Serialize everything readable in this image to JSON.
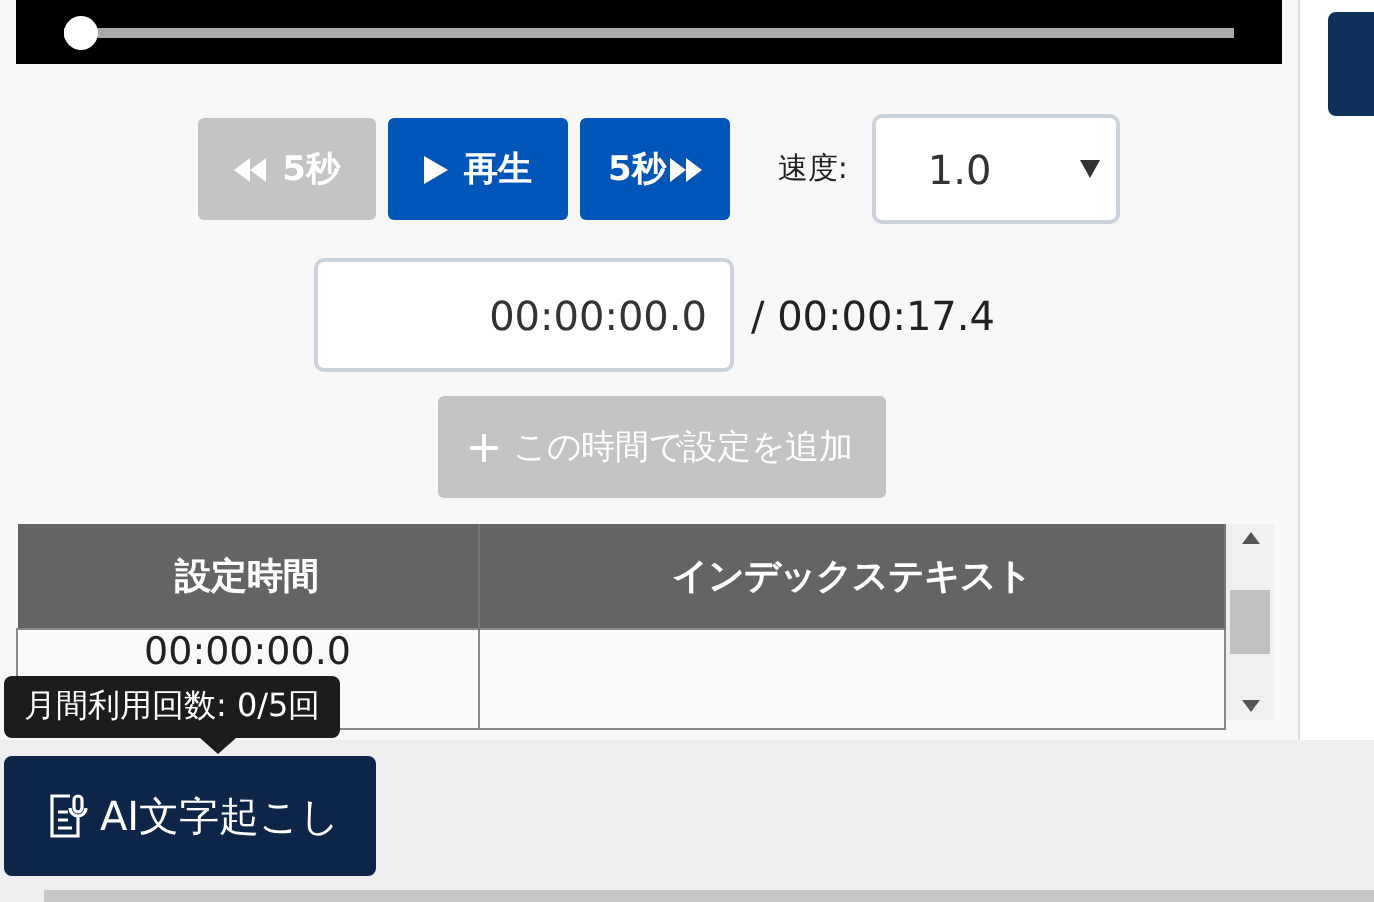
{
  "player": {
    "level": 0.0
  },
  "controls": {
    "back_button": {
      "label": "5秒",
      "disabled": true
    },
    "play_button": {
      "label": "再生",
      "disabled": false
    },
    "forward_button": {
      "label": "5秒",
      "disabled": false
    },
    "speed_label": "速度:",
    "speed_value": "1.0"
  },
  "time": {
    "current": "00:00:00.0",
    "total": "/ 00:00:17.4"
  },
  "add_button": {
    "label": "この時間で設定を追加",
    "disabled": true
  },
  "table": {
    "columns": [
      "設定時間",
      "インデックステキスト"
    ],
    "rows": [
      [
        "00:00:00.0",
        ""
      ]
    ]
  },
  "tooltip": "月間利用回数: 0/5回",
  "ai_button": {
    "label": "AI文字起こし"
  }
}
